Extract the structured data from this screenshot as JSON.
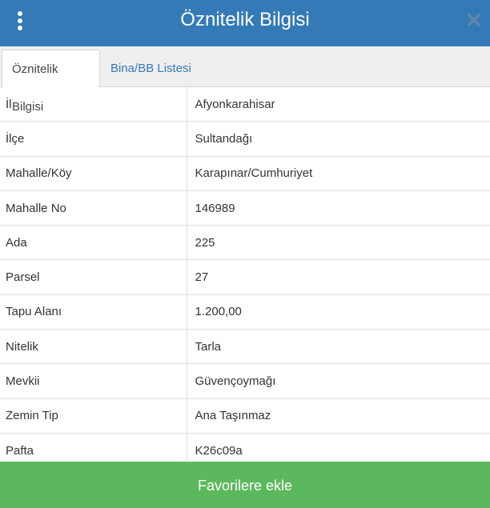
{
  "header": {
    "title": "Öznitelik Bilgisi",
    "menu_icon": "vertical-ellipsis-icon",
    "close_icon": "close-icon",
    "background_color": "#337ab7"
  },
  "tabs": [
    {
      "label": "Öznitelik Bilgisi",
      "active": true
    },
    {
      "label": "Bina/BB Listesi",
      "active": false
    }
  ],
  "attributes": [
    {
      "key": "İl",
      "value": "Afyonkarahisar"
    },
    {
      "key": "İlçe",
      "value": "Sultandağı"
    },
    {
      "key": "Mahalle/Köy",
      "value": "Karapınar/Cumhuriyet"
    },
    {
      "key": "Mahalle No",
      "value": "146989"
    },
    {
      "key": "Ada",
      "value": "225"
    },
    {
      "key": "Parsel",
      "value": "27"
    },
    {
      "key": "Tapu Alanı",
      "value": "1.200,00"
    },
    {
      "key": "Nitelik",
      "value": "Tarla"
    },
    {
      "key": "Mevkii",
      "value": "Güvençoymağı"
    },
    {
      "key": "Zemin Tip",
      "value": "Ana Taşınmaz"
    },
    {
      "key": "Pafta",
      "value": "K26c09a"
    }
  ],
  "footer": {
    "favorite_label": "Favorilere ekle",
    "button_color": "#5cb85c"
  }
}
